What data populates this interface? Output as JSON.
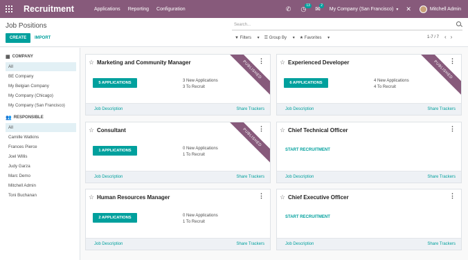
{
  "topbar": {
    "app_title": "Recruitment",
    "menu": [
      "Applications",
      "Reporting",
      "Configuration"
    ],
    "activity_count": "13",
    "message_count": "2",
    "company": "My Company (San Francisco)",
    "user": "Mitchell Admin",
    "color": "#875a7b"
  },
  "control_panel": {
    "breadcrumb": "Job Positions",
    "create_label": "CREATE",
    "import_label": "IMPORT",
    "search_placeholder": "Search...",
    "filters_label": "Filters",
    "group_by_label": "Group By",
    "favorites_label": "Favorites",
    "pager": "1-7 / 7"
  },
  "sidebar": {
    "company_heading": "COMPANY",
    "company_items": [
      "All",
      "BE Company",
      "My Belgian Company",
      "My Company (Chicago)",
      "My Company (San Francisco)"
    ],
    "responsible_heading": "RESPONSIBLE",
    "responsible_items": [
      "All",
      "Camille Watkins",
      "Frances Pierce",
      "Joel Willis",
      "Judy Garza",
      "Marc Demo",
      "Mitchell Admin",
      "Toni Buchanan"
    ]
  },
  "cards": [
    {
      "title": "Marketing and Community Manager",
      "button": "5 APPLICATIONS",
      "new_apps": "3 New Applications",
      "to_recruit": "3 To Recruit",
      "published": "PUBLISHED"
    },
    {
      "title": "Experienced Developer",
      "button": "6 APPLICATIONS",
      "new_apps": "4 New Applications",
      "to_recruit": "4 To Recruit",
      "published": "PUBLISHED"
    },
    {
      "title": "Consultant",
      "button": "1 APPLICATIONS",
      "new_apps": "0 New Applications",
      "to_recruit": "1 To Recruit",
      "published": "PUBLISHED"
    },
    {
      "title": "Chief Technical Officer",
      "start": "START RECRUITMENT"
    },
    {
      "title": "Human Resources Manager",
      "button": "2 APPLICATIONS",
      "new_apps": "0 New Applications",
      "to_recruit": "1 To Recruit"
    },
    {
      "title": "Chief Executive Officer",
      "start": "START RECRUITMENT"
    }
  ],
  "card_footer": {
    "job_description": "Job Description",
    "share_trackers": "Share Trackers"
  },
  "accent": "#00a09d"
}
